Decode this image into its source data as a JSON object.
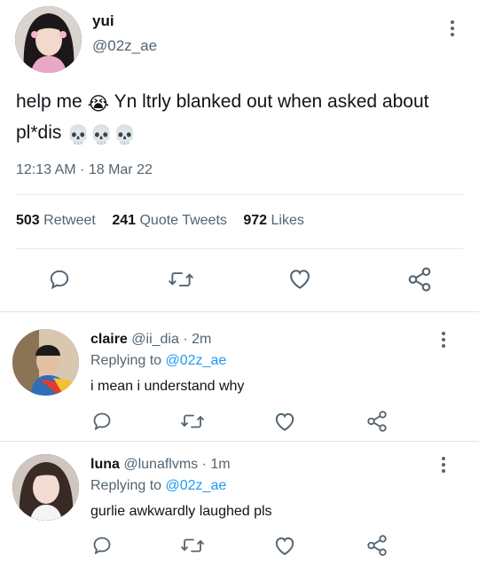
{
  "tweet": {
    "name": "yui",
    "handle": "@02z_ae",
    "text_part1": "help me",
    "text_part2": "Yn ltrly blanked out when asked about pl*dis",
    "emoji_crying": "😭",
    "emoji_skulls": "💀💀💀",
    "timestamp": "12:13 AM · 18 Mar 22",
    "stats": {
      "retweets_count": "503",
      "retweets_label": "Retweet",
      "quotes_count": "241",
      "quotes_label": "Quote Tweets",
      "likes_count": "972",
      "likes_label": "Likes"
    }
  },
  "replies": [
    {
      "name": "claire",
      "handle": "@ii_dia",
      "time": "2m",
      "replying_prefix": "Replying to",
      "replying_to": "@02z_ae",
      "text": "i mean i understand why"
    },
    {
      "name": "luna",
      "handle": "@lunaflvms",
      "time": "1m",
      "replying_prefix": "Replying to",
      "replying_to": "@02z_ae",
      "text": "gurlie awkwardly laughed pls"
    }
  ],
  "icons": [
    "reply-icon",
    "retweet-icon",
    "like-icon",
    "share-icon",
    "more-icon"
  ],
  "colors": {
    "link": "#1d9bf0",
    "muted": "#536471",
    "text": "#0f1419"
  }
}
